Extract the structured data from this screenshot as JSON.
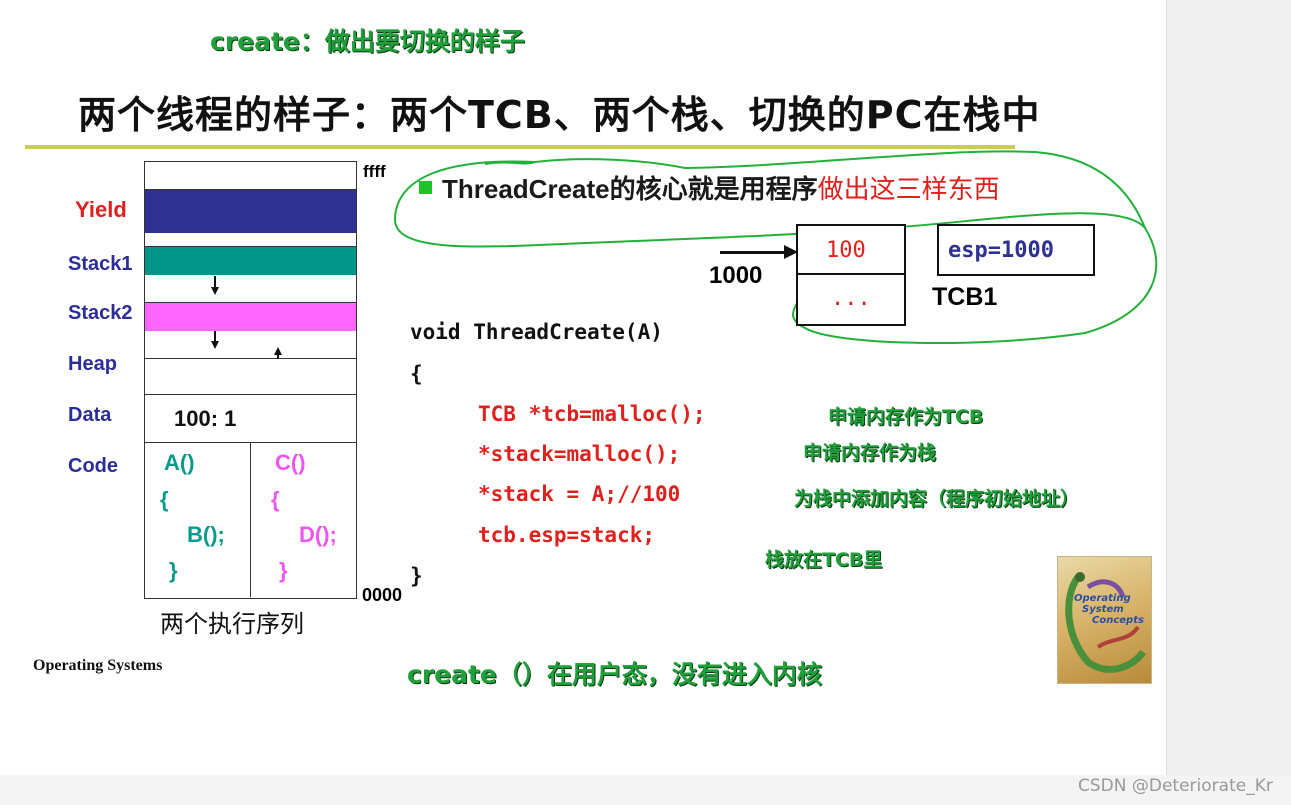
{
  "top_note": "create：做出要切换的样子",
  "title": "两个线程的样子：两个TCB、两个栈、切换的PC在栈中",
  "memory": {
    "top_addr": "ffff",
    "bottom_addr": "0000",
    "labels": {
      "yield": "Yield",
      "stack1": "Stack1",
      "stack2": "Stack2",
      "heap": "Heap",
      "data": "Data",
      "code": "Code"
    },
    "data_value": "100: 1",
    "code_left": [
      "A()",
      "{",
      "B();",
      "}"
    ],
    "code_right": [
      "C()",
      "{",
      "D();",
      "}"
    ],
    "caption": "两个执行序列"
  },
  "bullet": {
    "text": "ThreadCreate的核心就是用程序",
    "highlight": "做出这三样东西"
  },
  "tcb": {
    "pointer_label": "1000",
    "cell_top": "100",
    "cell_bottom": "...",
    "esp": "esp=1000",
    "name": "TCB1"
  },
  "code": {
    "signature": "void ThreadCreate(A)",
    "open": "{",
    "lines": [
      "TCB *tcb=malloc();",
      "*stack=malloc();",
      "*stack = A;//100",
      "tcb.esp=stack;"
    ],
    "close": "}"
  },
  "annotations": [
    "申请内存作为TCB",
    "申请内存作为栈",
    "为栈中添加内容（程序初始地址）",
    "栈放在TCB里"
  ],
  "footer_left": "Operating Systems",
  "bottom_note": "create（）在用户态，没有进入内核",
  "book": {
    "title_lines": [
      "Operating",
      "System",
      "Concepts"
    ]
  },
  "watermark": "CSDN @Deteriorate_Kr",
  "colors": {
    "yield": "#2e3192",
    "stack1": "#00968a",
    "stack2": "#ff66ff",
    "annotation_green": "#1fa03a",
    "title_underline": "#c9cf4a",
    "red": "#e0201c"
  }
}
